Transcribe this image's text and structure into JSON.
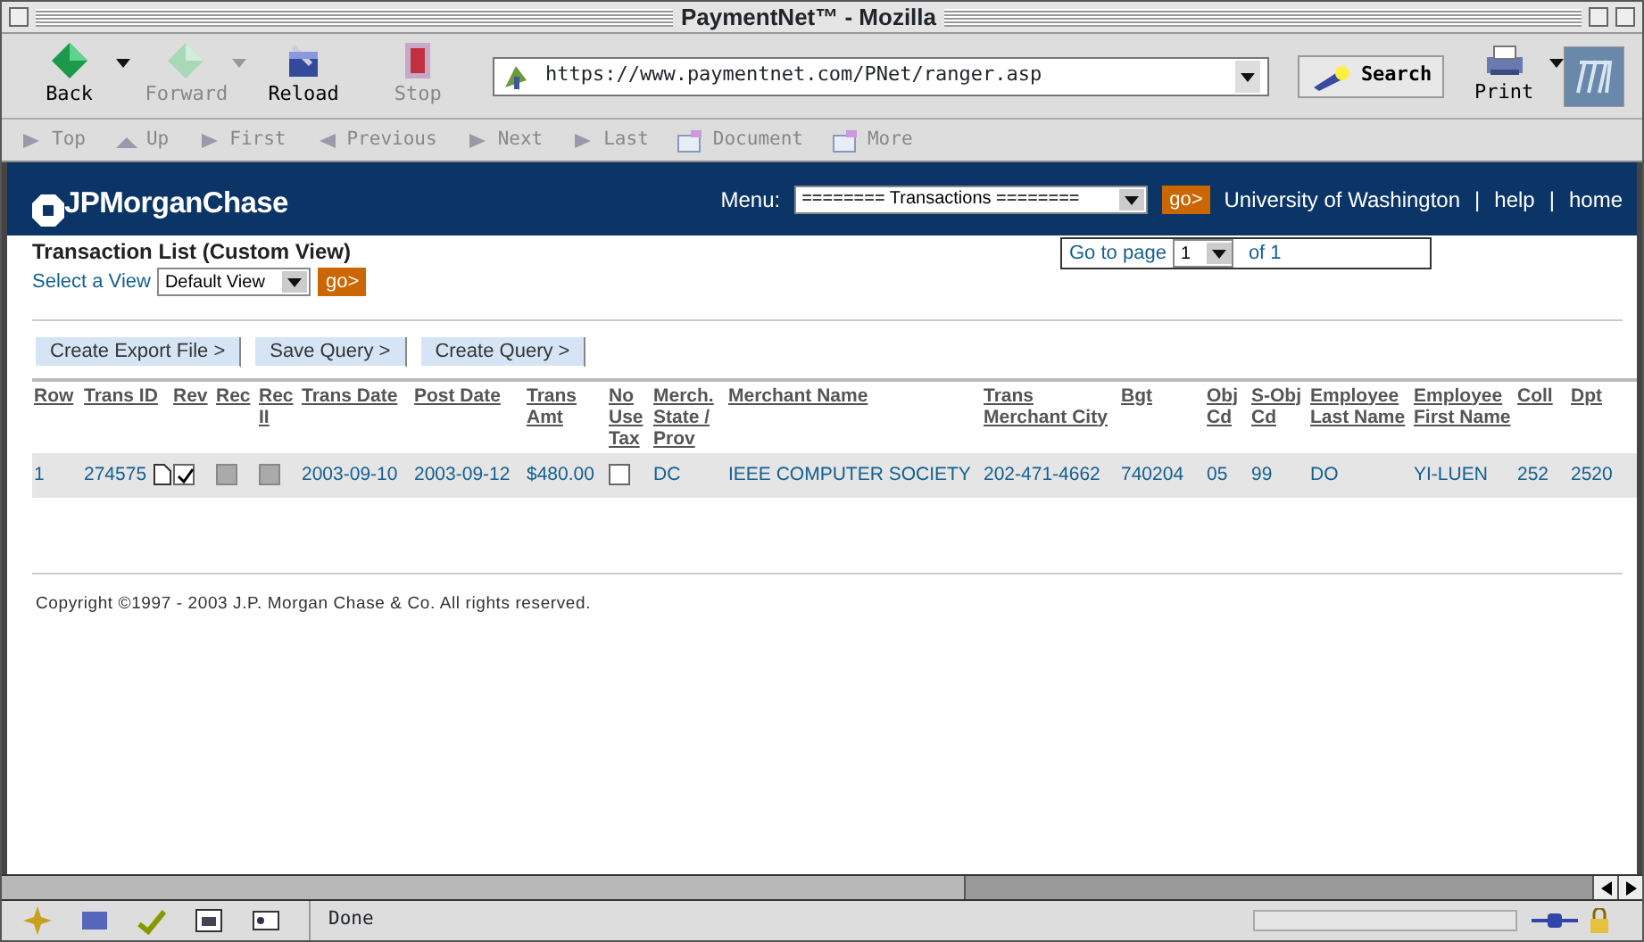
{
  "window": {
    "title": "PaymentNet™ - Mozilla"
  },
  "toolbar": {
    "buttons": [
      {
        "label": "Back",
        "disabled": false,
        "has_menu": true
      },
      {
        "label": "Forward",
        "disabled": true,
        "has_menu": true
      },
      {
        "label": "Reload",
        "disabled": false,
        "has_menu": false
      },
      {
        "label": "Stop",
        "disabled": true,
        "has_menu": false
      }
    ],
    "url": "https://www.paymentnet.com/PNet/ranger.asp",
    "search": "Search",
    "print": "Print"
  },
  "nav_bar": [
    "Top",
    "Up",
    "First",
    "Previous",
    "Next",
    "Last",
    "Document",
    "More"
  ],
  "header": {
    "logo": "JPMorganChase",
    "menu_label": "Menu:",
    "menu_value": "======== Transactions ========",
    "go": "go>",
    "links": [
      {
        "text": "University of Washington",
        "kind": "org"
      },
      {
        "text": "|",
        "kind": "sep"
      },
      {
        "text": "help",
        "kind": "link"
      },
      {
        "text": "|",
        "kind": "sep"
      },
      {
        "text": "home",
        "kind": "link"
      }
    ]
  },
  "page": {
    "title": "Transaction List (Custom View)",
    "view_label": "Select a View",
    "view_value": "Default View",
    "view_go": "go>",
    "pager": {
      "label": "Go to page",
      "value": "1",
      "total": "of 1"
    },
    "actions": [
      "Create Export File >",
      "Save Query >",
      "Create Query >"
    ]
  },
  "table": {
    "columns": [
      "Row",
      "Trans ID",
      "Rev",
      "Rec",
      "Rec II",
      "Trans Date",
      "Post Date",
      "Trans Amt",
      "No Use Tax",
      "Merch. State / Prov",
      "Merchant Name",
      "Trans Merchant City",
      "Bgt",
      "Obj Cd",
      "S-Obj Cd",
      "Employee Last Name",
      "Employee First Name",
      "Coll",
      "Dpt"
    ],
    "rows": [
      {
        "cells": [
          {
            "kind": "text",
            "text": "1"
          },
          {
            "kind": "doc",
            "text": "274575"
          },
          {
            "kind": "checkbox",
            "checked": true,
            "disabled": false
          },
          {
            "kind": "checkbox",
            "checked": false,
            "disabled": true
          },
          {
            "kind": "checkbox",
            "checked": false,
            "disabled": true
          },
          {
            "kind": "text",
            "text": "2003-09-10"
          },
          {
            "kind": "text",
            "text": "2003-09-12"
          },
          {
            "kind": "text",
            "text": "$480.00"
          },
          {
            "kind": "checkbox",
            "checked": false,
            "disabled": false
          },
          {
            "kind": "text",
            "text": "DC"
          },
          {
            "kind": "text",
            "text": "IEEE COMPUTER SOCIETY"
          },
          {
            "kind": "text",
            "text": "202-471-4662"
          },
          {
            "kind": "text",
            "text": "740204"
          },
          {
            "kind": "text",
            "text": "05"
          },
          {
            "kind": "text",
            "text": "99"
          },
          {
            "kind": "text",
            "text": "DO"
          },
          {
            "kind": "text",
            "text": "YI-LUEN"
          },
          {
            "kind": "text",
            "text": "252"
          },
          {
            "kind": "text",
            "text": "2520"
          }
        ]
      }
    ]
  },
  "footer": "Copyright ©1997 - 2003 J.P. Morgan Chase & Co. All rights reserved.",
  "status_bar": {
    "text": "Done",
    "progress": {
      "level": 0
    }
  }
}
